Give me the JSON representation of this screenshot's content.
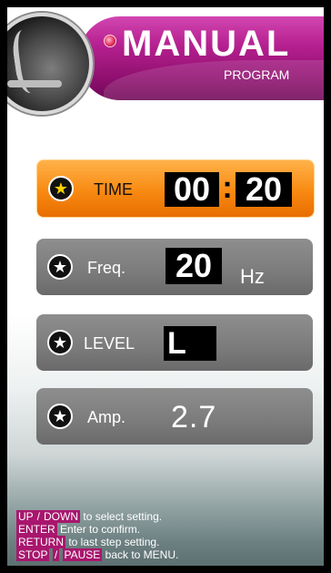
{
  "header": {
    "title": "MANUAL",
    "subtitle": "PROGRAM"
  },
  "settings": {
    "time": {
      "label": "TIME",
      "minutes": "00",
      "separator": ":",
      "seconds": "20"
    },
    "freq": {
      "label": "Freq.",
      "value": "20",
      "unit": "Hz"
    },
    "level": {
      "label": "LEVEL",
      "value": "L"
    },
    "amp": {
      "label": "Amp.",
      "value": "2.7"
    }
  },
  "help": {
    "line1": {
      "key_up": "UP",
      "slash": "/",
      "key_down": "DOWN",
      "text": "to select setting."
    },
    "line2": {
      "key": "ENTER",
      "text": "Enter to confirm."
    },
    "line3": {
      "key": "RETURN",
      "text": "to last step setting."
    },
    "line4": {
      "key_stop": "STOP",
      "slash": "/",
      "key_pause": "PAUSE",
      "text": "back to MENU."
    }
  },
  "icons": {
    "row_icon": "star-icon",
    "logo": "machine-logo"
  },
  "colors": {
    "banner": "#b5208f",
    "active_row": "#f88a12",
    "row": "#7b7b7b",
    "help_key": "#a8166d"
  }
}
